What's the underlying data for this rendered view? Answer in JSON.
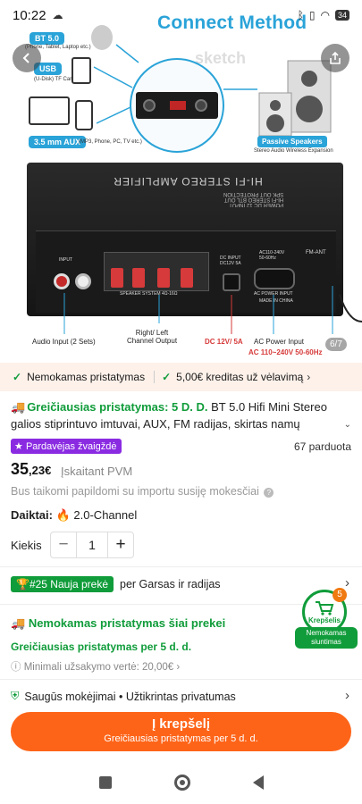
{
  "status": {
    "time": "10:22",
    "battery": "34"
  },
  "hero": {
    "diagram_title": "Connect Method",
    "watermark": "sketch",
    "sources": [
      {
        "label": "BT 5.0",
        "sub": "(Phone, Tablet, Laptop etc.)"
      },
      {
        "label": "USB",
        "sub": "(U-Disk)\nTF Card"
      },
      {
        "label": "3.5 mm AUX",
        "sub": "(MP3, Phone, PC, TV etc.)"
      }
    ],
    "speakers_label": "Passive Speakers",
    "speakers_sub": "Stereo Audio Wireless Expansion",
    "amp_top_text": "HI-FI STEREO AMPLIFIER",
    "amp_top_small": "POWER DC 12 INPUT\nHI-FI STEREO BTL OUT\nSPK OUT PROTECTION",
    "fm_ant": "FM-ANT",
    "input_label": "INPUT",
    "speaker_system_label": "SPEAKER SYSTEM 4Ω-16Ω",
    "dc_input_label": "DC INPUT\nDC12V 5A",
    "ac_label": "AC110-240V\n50-60Hz",
    "ac_power_input": "AC POWER INPUT",
    "made_in": "MADE IN CHINA",
    "captions": {
      "audio_input": "Audio Input (2 Sets)",
      "right_left": "Right/ Left\nChannel Output",
      "dc": "DC 12V/ 5A",
      "ac_power": "AC Power Input",
      "ac_range": "AC 110~240V 50-60Hz"
    },
    "pager": "6/7"
  },
  "delivery_strip": {
    "free_shipping": "Nemokamas pristatymas",
    "credit": "5,00€ kreditas už vėlavimą"
  },
  "product": {
    "fast_label": "Greičiausias pristatymas: 5 D. D.",
    "title_rest": " BT 5.0 Hifi Mini Stereo galios stiprintuvo imtuvai, AUX, FM radijas, skirtas namų",
    "seller_badge": "Pardavėjas žvaigždė",
    "sold": "67 parduota",
    "price_int": "35",
    "price_dec": ",23€",
    "vat": "Įskaitant PVM",
    "import_note": "Bus taikomi papildomi su importu susiję mokesčiai",
    "items_key": "Daiktai:",
    "items_val": "2.0-Channel",
    "qty_label": "Kiekis",
    "qty_value": "1"
  },
  "ranking": {
    "badge": "#25 Nauja prekė",
    "text": "per Garsas ir radijas"
  },
  "shipping": {
    "free": "Nemokamas pristatymas šiai prekei",
    "fast": "Greičiausias pristatymas per 5 d. d.",
    "min_order": "Minimali užsakymo vertė: 20,00€"
  },
  "cart": {
    "count": "5",
    "label": "Krepšelis",
    "pill": "Nemokamas siuntimas"
  },
  "secure": {
    "text": "Saugūs mokėjimai • Užtikrintas privatumas"
  },
  "cta": {
    "main": "Į krepšelį",
    "sub": "Greičiausias pristatymas per 5 d. d."
  },
  "colors": {
    "accent": "#fe6418",
    "green": "#109c3a",
    "blue": "#2aa3d8",
    "purple": "#8a2be2"
  }
}
